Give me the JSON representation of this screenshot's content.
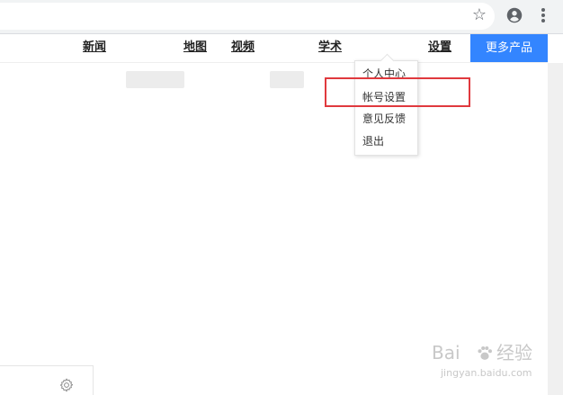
{
  "nav": {
    "links": [
      "新闻",
      "地图",
      "视频",
      "学术",
      "设置"
    ],
    "more_products": "更多产品"
  },
  "dropdown": {
    "items": [
      "个人中心",
      "帐号设置",
      "意见反馈",
      "退出"
    ]
  },
  "icons": {
    "star": "star-icon",
    "account": "account-circle-icon",
    "menu": "more-vert-icon",
    "settings": "gear-icon"
  },
  "colors": {
    "accent": "#3385ff",
    "highlight": "#e0393e"
  },
  "watermark": {
    "brand_left": "Bai",
    "brand_right": "经验",
    "url": "jingyan.baidu.com"
  }
}
